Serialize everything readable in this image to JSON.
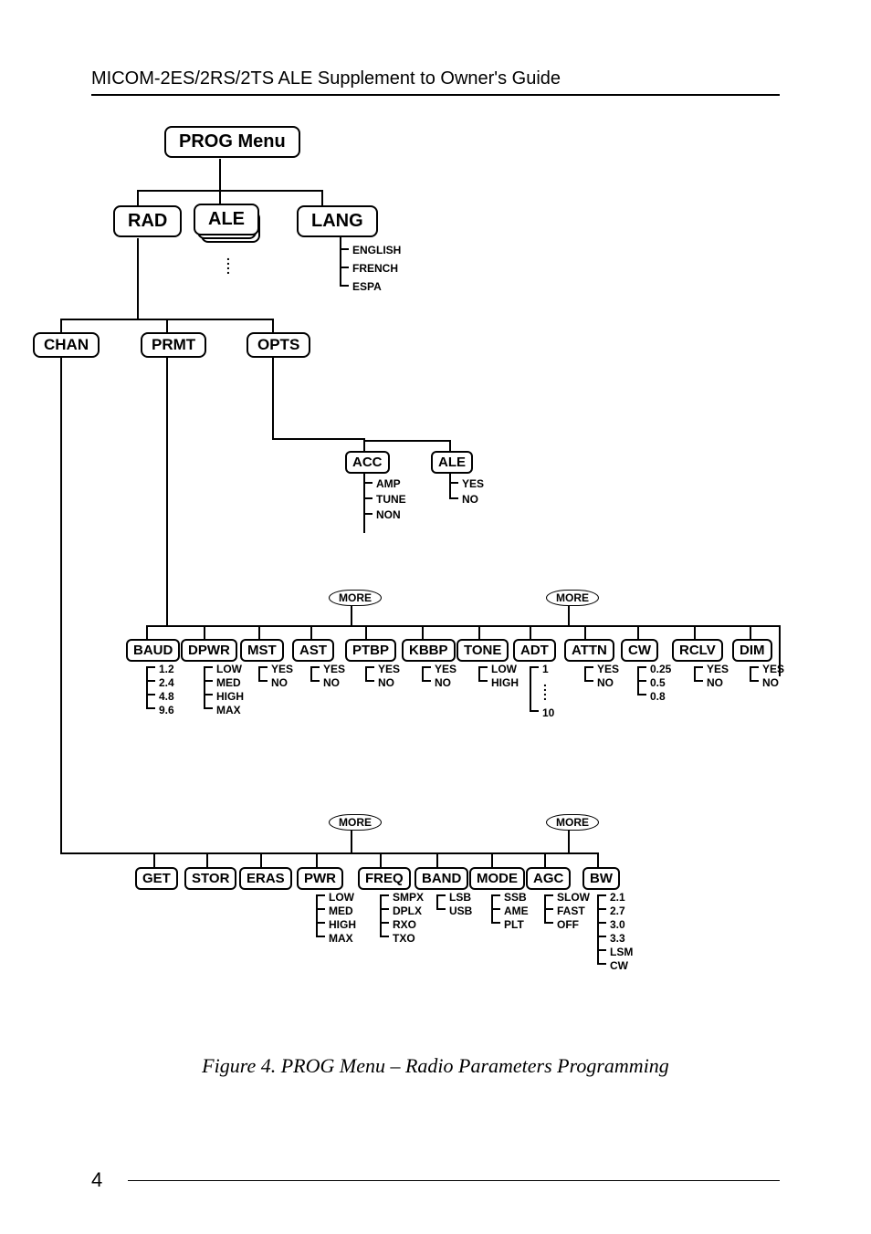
{
  "header": "MICOM-2ES/2RS/2TS ALE Supplement to Owner's Guide",
  "caption": "Figure 4. PROG Menu – Radio Parameters Programming",
  "pagenum": "4",
  "more": "MORE",
  "nodes": {
    "prog": "PROG Menu",
    "rad": "RAD",
    "ale_top": "ALE",
    "lang": "LANG",
    "chan": "CHAN",
    "prmt": "PRMT",
    "opts": "OPTS",
    "acc": "ACC",
    "ale_sub": "ALE",
    "baud": "BAUD",
    "dpwr": "DPWR",
    "mst": "MST",
    "ast": "AST",
    "ptbp": "PTBP",
    "kbbp": "KBBP",
    "tone": "TONE",
    "adt": "ADT",
    "attn": "ATTN",
    "cw": "CW",
    "rclv": "RCLV",
    "dim": "DIM",
    "get": "GET",
    "stor": "STOR",
    "eras": "ERAS",
    "pwr": "PWR",
    "freq": "FREQ",
    "band": "BAND",
    "mode": "MODE",
    "agc": "AGC",
    "bw": "BW"
  },
  "opts": {
    "lang": [
      "ENGLISH",
      "FRENCH",
      "ESPA"
    ],
    "acc": [
      "AMP",
      "TUNE",
      "NON"
    ],
    "ale_sub": [
      "YES",
      "NO"
    ],
    "baud": [
      "1.2",
      "2.4",
      "4.8",
      "9.6"
    ],
    "dpwr": [
      "LOW",
      "MED",
      "HIGH",
      "MAX"
    ],
    "mst": [
      "YES",
      "NO"
    ],
    "ast": [
      "YES",
      "NO"
    ],
    "ptbp": [
      "YES",
      "NO"
    ],
    "kbbp": [
      "YES",
      "NO"
    ],
    "tone": [
      "LOW",
      "HIGH"
    ],
    "adt_top": "1",
    "adt_bottom": "10",
    "attn": [
      "YES",
      "NO"
    ],
    "cw": [
      "0.25",
      "0.5",
      "0.8"
    ],
    "rclv": [
      "YES",
      "NO"
    ],
    "dim": [
      "YES",
      "NO"
    ],
    "pwr": [
      "LOW",
      "MED",
      "HIGH",
      "MAX"
    ],
    "freq": [
      "SMPX",
      "DPLX",
      "RXO",
      "TXO"
    ],
    "band": [
      "LSB",
      "USB"
    ],
    "mode": [
      "SSB",
      "AME",
      "PLT"
    ],
    "agc": [
      "SLOW",
      "FAST",
      "OFF"
    ],
    "bw": [
      "2.1",
      "2.7",
      "3.0",
      "3.3",
      "LSM",
      "CW"
    ]
  }
}
